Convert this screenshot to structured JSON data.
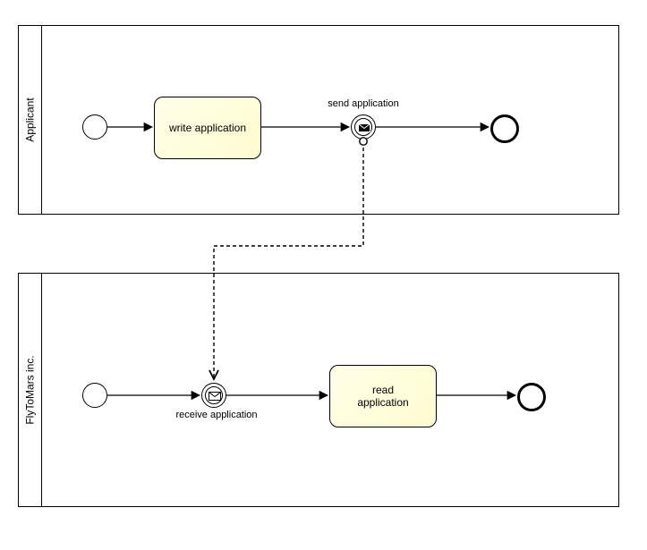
{
  "pools": {
    "applicant": {
      "label": "Applicant"
    },
    "flytomars": {
      "label": "FlyToMars inc."
    }
  },
  "tasks": {
    "write_application": "write application",
    "read_application": "read\napplication"
  },
  "events": {
    "send_application": {
      "label": "send application"
    },
    "receive_application": {
      "label": "receive application"
    }
  }
}
